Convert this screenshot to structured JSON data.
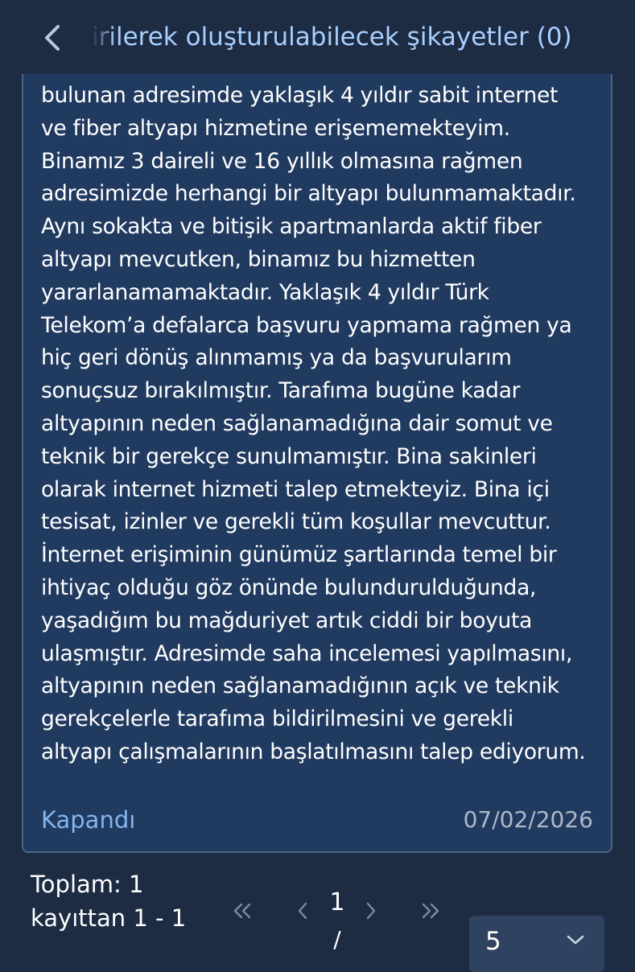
{
  "header": {
    "title": "irilerek oluşturulabilecek şikayetler (0)",
    "back_icon": "chevron-left-icon"
  },
  "complaint": {
    "text": "bulunan adresimde yaklaşık 4 yıldır sabit internet\nve fiber altyapı hizmetine erişememekteyim.\nBinamız 3 daireli ve 16 yıllık olmasına rağmen\nadresimizde herhangi bir altyapı bulunmamaktadır.\nAynı sokakta ve bitişik apartmanlarda aktif fiber\naltyapı mevcutken, binamız bu hizmetten\nyararlanamamaktadır. Yaklaşık 4 yıldır Türk\nTelekom’a defalarca başvuru yapmama rağmen ya\nhiç geri dönüş alınmamış ya da başvurularım\nsonuçsuz bırakılmıştır. Tarafıma bugüne kadar\naltyapının neden sağlanamadığına dair somut ve\nteknik bir gerekçe sunulmamıştır. Bina sakinleri\nolarak internet hizmeti talep etmekteyiz. Bina içi\ntesisat, izinler ve gerekli tüm koşullar mevcuttur.\nİnternet erişiminin günümüz şartlarında temel bir\nihtiyaç olduğu göz önünde bulundurulduğunda,\nyaşadığım bu mağduriyet artık ciddi bir boyuta\nulaşmıştır. Adresimde saha incelemesi yapılmasını,\naltyapının neden sağlanamadığının açık ve teknik\ngerekçelerle tarafıma bildirilmesini ve gerekli\naltyapı çalışmalarının başlatılmasını talep ediyorum.",
    "status": "Kapandı",
    "date": "07/02/2026"
  },
  "pagination": {
    "total_text": "Toplam: 1 kayıttan 1 - 1",
    "current_page": "1",
    "separator": "/",
    "page_size": "5",
    "icons": {
      "first": "double-chevron-left-icon",
      "prev": "chevron-left-icon",
      "next": "chevron-right-icon",
      "last": "double-chevron-right-icon",
      "dropdown": "chevron-down-icon"
    }
  },
  "colors": {
    "background": "#1d2b43",
    "card": "#213a60",
    "card_border": "#4a6588",
    "title": "#a9d0ff",
    "status": "#83b5ef",
    "date": "#aeb8c5",
    "select_bg": "#2f4260"
  }
}
